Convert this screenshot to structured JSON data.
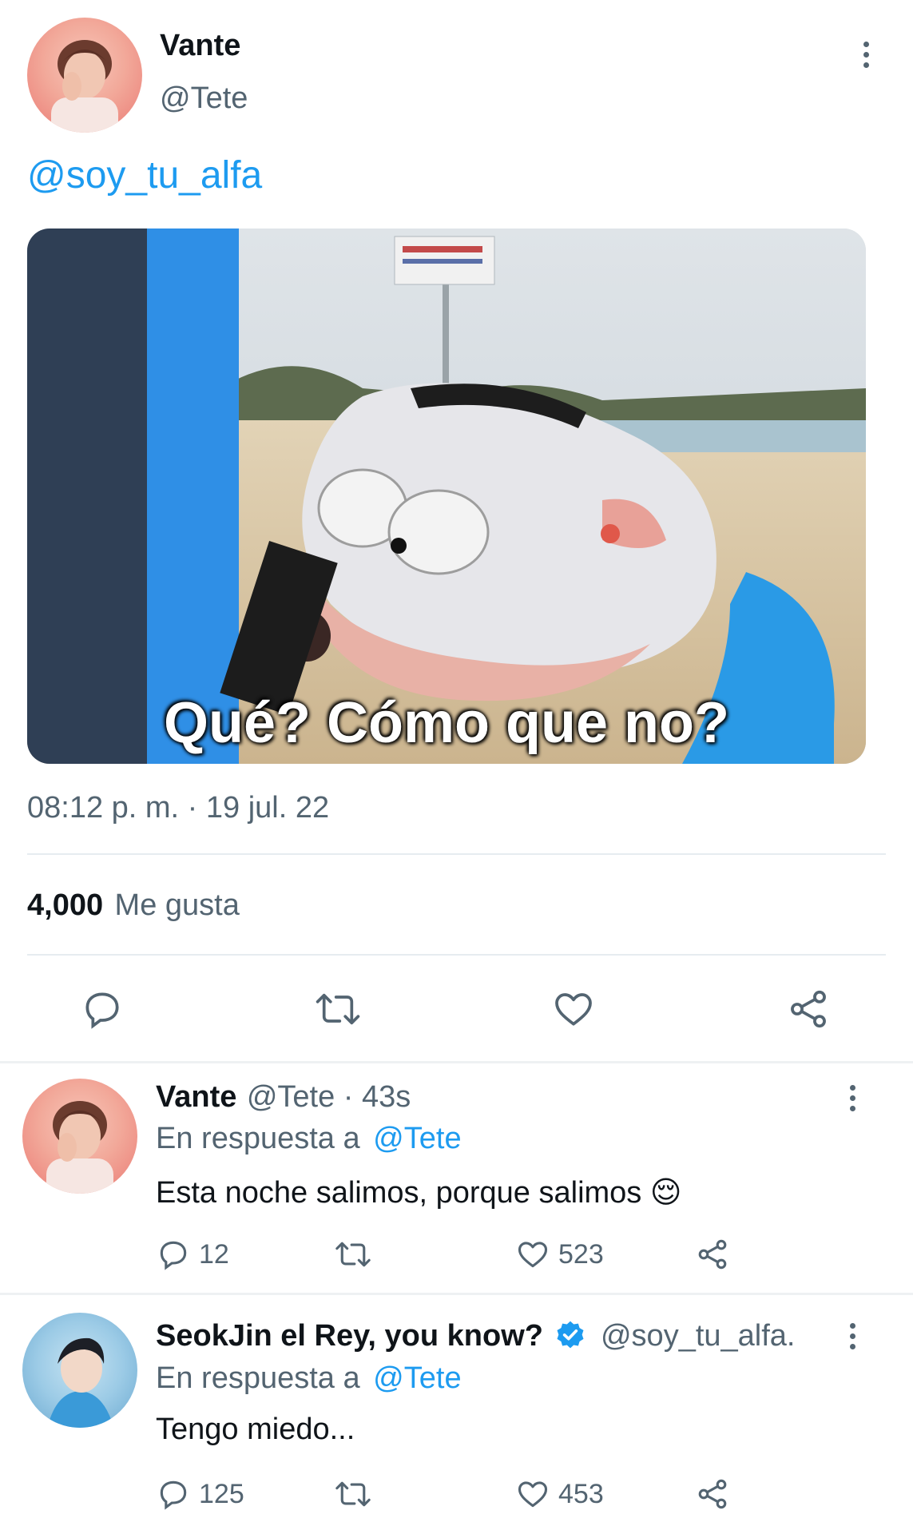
{
  "main_tweet": {
    "author_name": "Vante",
    "author_handle": "@Tete",
    "text_mention": "@soy_tu_alfa",
    "media_caption": "Qué? Cómo que no?",
    "timestamp": "08:12 p. m. · 19 jul. 22",
    "likes_count": "4,000",
    "likes_label": "Me gusta",
    "actions": [
      "reply-icon",
      "retweet-icon",
      "like-icon",
      "share-icon"
    ]
  },
  "replies": [
    {
      "author_name": "Vante",
      "author_handle": "@Tete · 43s",
      "reply_prefix": "En respuesta a",
      "reply_to": "@Tete",
      "text": "Esta noche salimos, porque salimos 😌",
      "reply_count": "12",
      "like_count": "523"
    },
    {
      "author_name": "SeokJin el Rey, you know?",
      "verified": true,
      "author_handle": "@soy_tu_alfa.",
      "reply_prefix": "En respuesta a",
      "reply_to": "@Tete",
      "text": "Tengo miedo...",
      "reply_count": "125",
      "like_count": "453"
    }
  ],
  "colors": {
    "link": "#1d9bf0",
    "muted": "#536471",
    "text": "#0f1419",
    "divider": "#e6ecf0"
  }
}
